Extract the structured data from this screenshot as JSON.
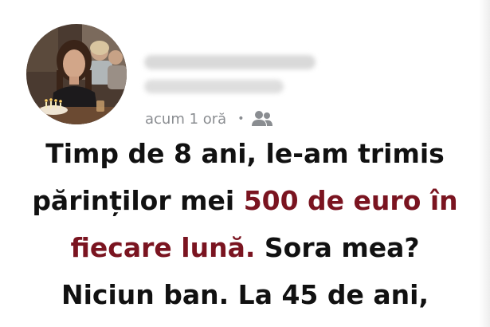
{
  "post": {
    "time_ago": "acum 1 oră",
    "separator": "•",
    "audience_icon": "friends-icon",
    "story": {
      "line1": "Timp de 8 ani, le-am trimis",
      "line2_a": "părinților mei ",
      "line2_b": "500 de euro în",
      "line3_a": "fiecare lună.",
      "line3_b": " Sora mea?",
      "line4": "Niciun ban. La 45 de ani,"
    },
    "highlight_color": "#7a1420",
    "text_color": "#111111"
  }
}
